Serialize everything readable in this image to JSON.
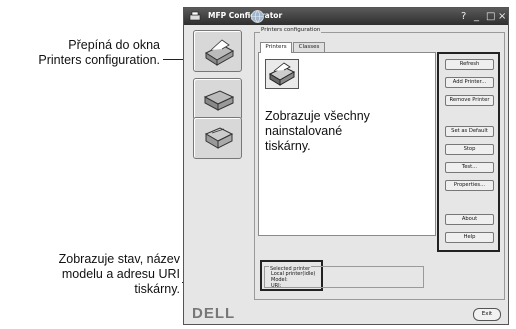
{
  "callouts": {
    "top": [
      "Přepíná do okna",
      "Printers configuration."
    ],
    "bottom": [
      "Zobrazuje stav, název",
      "modelu a adresu URI",
      "tiskárny."
    ],
    "list": [
      "Zobrazuje všechny",
      "nainstalované",
      "tiskárny."
    ]
  },
  "window": {
    "title": "MFP Configurator",
    "controls": {
      "help": "?",
      "minimize": "_",
      "maximize": "□",
      "close": "×"
    }
  },
  "sidebar": {
    "items": [
      {
        "name": "printers-config-icon"
      },
      {
        "name": "scanners-config-icon"
      },
      {
        "name": "ports-config-icon"
      }
    ]
  },
  "printers_config": {
    "group_label": "Printers configuration",
    "tabs": [
      {
        "label": "Printers",
        "selected": true
      },
      {
        "label": "Classes",
        "selected": false
      }
    ],
    "buttons": [
      "Refresh",
      "Add Printer...",
      "Remove Printer",
      "Set as Default",
      "Stop",
      "Test...",
      "Properties...",
      "About",
      "Help"
    ]
  },
  "selected_printer": {
    "title": "Selected printer",
    "lines": [
      "Local printer(idle)",
      "Model:",
      "URI:"
    ]
  },
  "footer": {
    "brand": "DELL",
    "exit_label": "Exit"
  }
}
